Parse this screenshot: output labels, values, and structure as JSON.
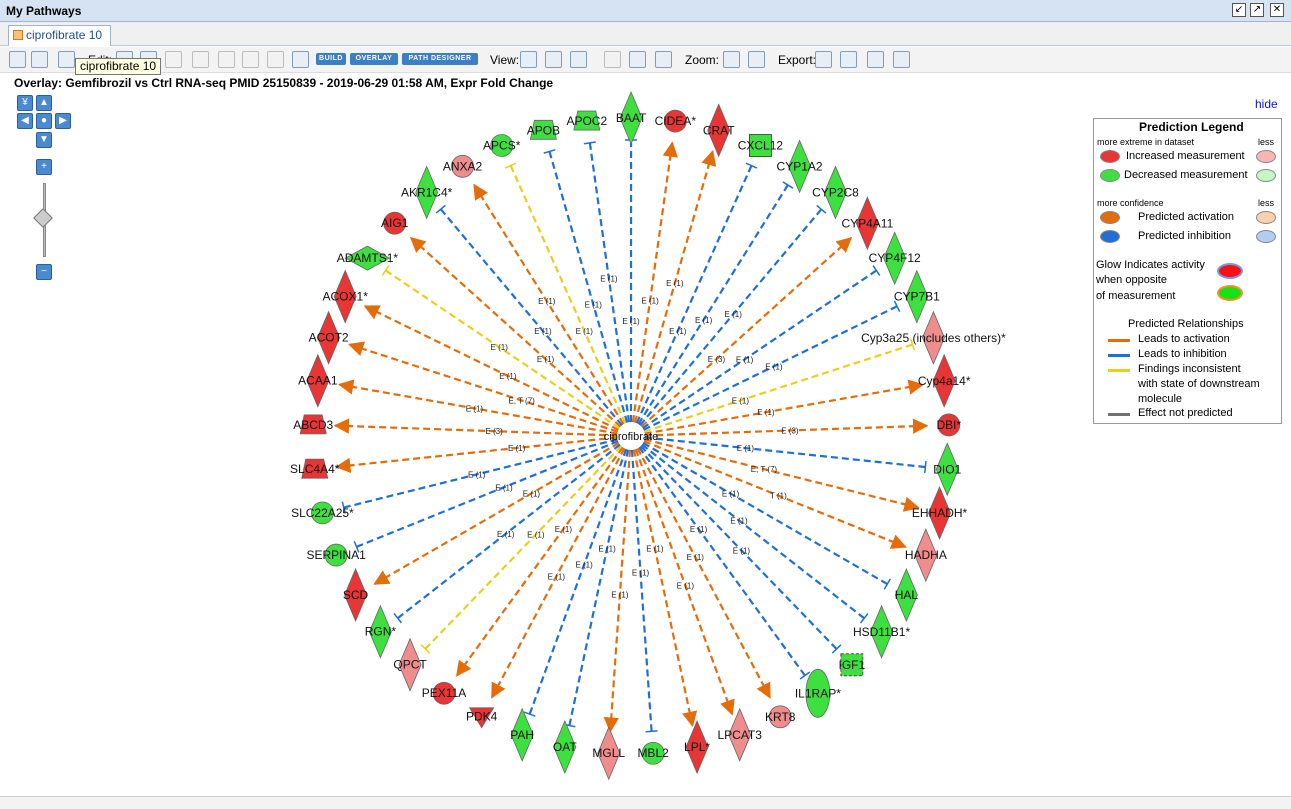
{
  "window": {
    "title": "My Pathways"
  },
  "tab": {
    "label": "ciprofibrate 10"
  },
  "tooltip": "ciprofibrate 10",
  "toolbar": {
    "edit_label": "Edit:",
    "build_label": "BUILD",
    "overlay_label": "OVERLAY",
    "path_designer_label": "PATH DESIGNER",
    "view_label": "View:",
    "zoom_label": "Zoom:",
    "export_label": "Export:"
  },
  "overlay_title": "Overlay: Gemfibrozil vs Ctrl RNA-seq PMID 25150839 - 2019-06-29 01:58 AM, Expr Fold Change",
  "hide_link": "hide",
  "legend": {
    "title": "Prediction Legend",
    "extreme": "more extreme in dataset",
    "less": "less",
    "increased": "Increased measurement",
    "decreased": "Decreased measurement",
    "confidence": "more confidence",
    "activation": "Predicted activation",
    "inhibition": "Predicted inhibition",
    "glow1": "Glow Indicates activity",
    "glow2": "when opposite",
    "glow3": "of measurement",
    "relationships": "Predicted Relationships",
    "leads_activation": "Leads to activation",
    "leads_inhibition": "Leads to inhibition",
    "inconsistent1": "Findings inconsistent",
    "inconsistent2": "with state of downstream",
    "inconsistent3": "molecule",
    "not_predicted": "Effect not predicted",
    "colors": {
      "orange": "#e46c0a",
      "blue": "#1f6fd6",
      "yellow": "#e8cf1e",
      "gray": "#707070",
      "red": "#e83535",
      "green": "#3ee040"
    }
  },
  "network": {
    "center": "ciprofibrate",
    "nodes": [
      {
        "label": "BAAT",
        "shape": "diamond",
        "color": "green",
        "edge": "blue",
        "edge_label": "E (1)"
      },
      {
        "label": "CIDEA*",
        "shape": "circle",
        "color": "red",
        "edge": "orange",
        "edge_label": "E (1)"
      },
      {
        "label": "CRAT",
        "shape": "diamond",
        "color": "red",
        "edge": "orange",
        "edge_label": "E (1)"
      },
      {
        "label": "CXCL12",
        "shape": "square",
        "color": "green",
        "edge": "blue",
        "edge_label": "E (1)"
      },
      {
        "label": "CYP1A2",
        "shape": "diamond",
        "color": "green",
        "edge": "blue",
        "edge_label": "E (1)"
      },
      {
        "label": "CYP2C8",
        "shape": "diamond",
        "color": "green",
        "edge": "blue",
        "edge_label": "E (1)"
      },
      {
        "label": "CYP4A11",
        "shape": "diamond",
        "color": "red",
        "edge": "orange",
        "edge_label": "E (3)"
      },
      {
        "label": "CYP4F12",
        "shape": "diamond",
        "color": "green",
        "edge": "blue",
        "edge_label": "E (1)"
      },
      {
        "label": "CYP7B1",
        "shape": "diamond",
        "color": "green",
        "edge": "blue",
        "edge_label": "E (1)"
      },
      {
        "label": "Cyp3a25 (includes others)*",
        "shape": "diamond",
        "color": "pink",
        "edge": "yellow",
        "edge_label": "E (1)"
      },
      {
        "label": "Cyp4a14*",
        "shape": "diamond",
        "color": "red",
        "edge": "orange",
        "edge_label": "E (1)"
      },
      {
        "label": "DBI*",
        "shape": "circle",
        "color": "red",
        "edge": "orange",
        "edge_label": "E (3)"
      },
      {
        "label": "DIO1",
        "shape": "diamond",
        "color": "green",
        "edge": "blue",
        "edge_label": "E (1)"
      },
      {
        "label": "EHHADH*",
        "shape": "diamond",
        "color": "red",
        "edge": "orange",
        "edge_label": "E, T (7)"
      },
      {
        "label": "HADHA",
        "shape": "diamond",
        "color": "pink",
        "edge": "orange",
        "edge_label": "T (1)"
      },
      {
        "label": "HAL",
        "shape": "diamond",
        "color": "green",
        "edge": "blue",
        "edge_label": "E (1)"
      },
      {
        "label": "HSD11B1*",
        "shape": "diamond",
        "color": "green",
        "edge": "blue",
        "edge_label": "E (1)"
      },
      {
        "label": "IGF1",
        "shape": "square-dashed",
        "color": "green",
        "edge": "blue",
        "edge_label": "E (1)"
      },
      {
        "label": "IL1RAP*",
        "shape": "ellipse",
        "color": "green",
        "edge": "blue",
        "edge_label": "E (1)"
      },
      {
        "label": "KRT8",
        "shape": "circle",
        "color": "pink",
        "edge": "orange",
        "edge_label": "E (1)"
      },
      {
        "label": "LPCAT3",
        "shape": "diamond",
        "color": "pink",
        "edge": "orange",
        "edge_label": "E (1)"
      },
      {
        "label": "LPL*",
        "shape": "diamond",
        "color": "red",
        "edge": "orange",
        "edge_label": "E (1)"
      },
      {
        "label": "MBL2",
        "shape": "circle",
        "color": "green",
        "edge": "blue",
        "edge_label": "E (1)"
      },
      {
        "label": "MGLL",
        "shape": "diamond",
        "color": "pink",
        "edge": "orange",
        "edge_label": "E (1)"
      },
      {
        "label": "OAT",
        "shape": "diamond",
        "color": "green",
        "edge": "blue",
        "edge_label": "E (1)"
      },
      {
        "label": "PAH",
        "shape": "diamond",
        "color": "green",
        "edge": "blue",
        "edge_label": "E (1)"
      },
      {
        "label": "PDK4",
        "shape": "triangle-down",
        "color": "red",
        "edge": "orange",
        "edge_label": "E (1)"
      },
      {
        "label": "PEX11A",
        "shape": "circle",
        "color": "red",
        "edge": "orange",
        "edge_label": "E (1)"
      },
      {
        "label": "QPCT",
        "shape": "diamond",
        "color": "pink",
        "edge": "yellow",
        "edge_label": "E (1)"
      },
      {
        "label": "RGN*",
        "shape": "diamond",
        "color": "green",
        "edge": "blue",
        "edge_label": "E (1)"
      },
      {
        "label": "SCD",
        "shape": "diamond",
        "color": "red",
        "edge": "orange",
        "edge_label": "E (1)"
      },
      {
        "label": "SERPINA1",
        "shape": "circle",
        "color": "green",
        "edge": "blue",
        "edge_label": "E (1)"
      },
      {
        "label": "SLC22A25*",
        "shape": "circle",
        "color": "green",
        "edge": "blue",
        "edge_label": "E (1)"
      },
      {
        "label": "SLC4A4*",
        "shape": "trapezoid",
        "color": "red",
        "edge": "orange",
        "edge_label": "E (1)"
      },
      {
        "label": "ABCD3",
        "shape": "trapezoid",
        "color": "red",
        "edge": "orange",
        "edge_label": "E (3)"
      },
      {
        "label": "ACAA1",
        "shape": "diamond",
        "color": "red",
        "edge": "orange",
        "edge_label": "E (1)"
      },
      {
        "label": "ACOT2",
        "shape": "diamond",
        "color": "red",
        "edge": "orange",
        "edge_label": "E, T (7)"
      },
      {
        "label": "ACOX1*",
        "shape": "diamond",
        "color": "red",
        "edge": "orange",
        "edge_label": "E (1)"
      },
      {
        "label": "ADAMTS1*",
        "shape": "diamond-wide",
        "color": "green",
        "edge": "yellow",
        "edge_label": "E (1)"
      },
      {
        "label": "AIG1",
        "shape": "circle",
        "color": "red",
        "edge": "orange",
        "edge_label": "E (1)"
      },
      {
        "label": "AKR1C4*",
        "shape": "diamond",
        "color": "green",
        "edge": "blue",
        "edge_label": "E (1)"
      },
      {
        "label": "ANXA2",
        "shape": "circle",
        "color": "pink",
        "edge": "orange",
        "edge_label": "E (1)"
      },
      {
        "label": "APCS*",
        "shape": "circle",
        "color": "green",
        "edge": "yellow",
        "edge_label": "E (1)"
      },
      {
        "label": "APOB",
        "shape": "trapezoid",
        "color": "green",
        "edge": "blue",
        "edge_label": "E (1)"
      },
      {
        "label": "APOC2",
        "shape": "trapezoid",
        "color": "green",
        "edge": "blue",
        "edge_label": "E (1)"
      }
    ]
  }
}
